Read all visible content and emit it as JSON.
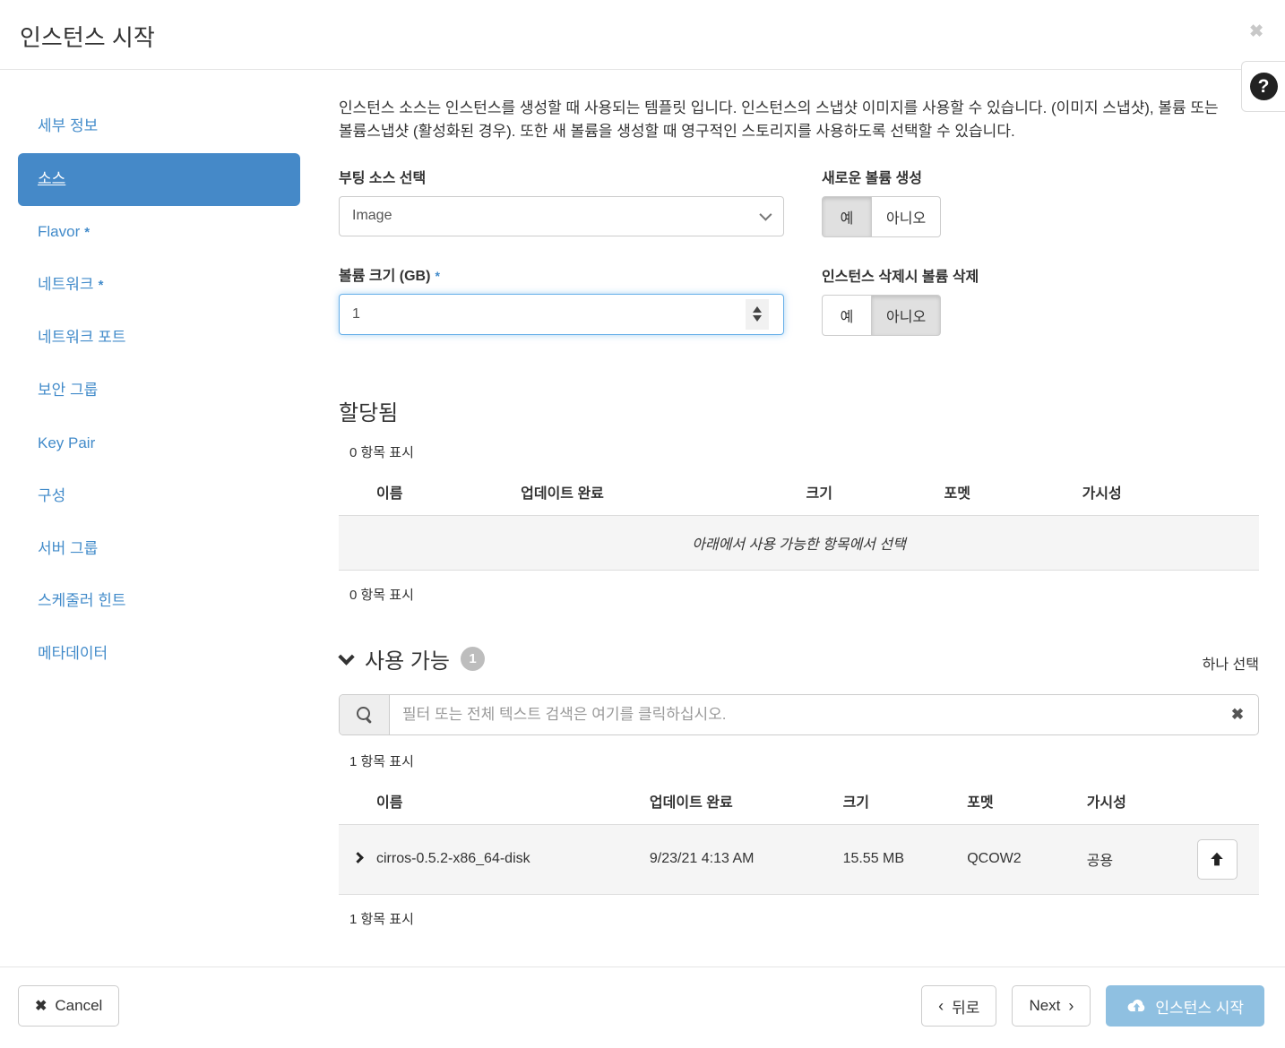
{
  "header": {
    "title": "인스턴스 시작",
    "close_icon": "✖",
    "help_icon": "?"
  },
  "sidebar": {
    "required_marker": "*",
    "items": [
      {
        "label": "세부 정보",
        "required": false,
        "active": false
      },
      {
        "label": "소스",
        "required": false,
        "active": true
      },
      {
        "label": "Flavor",
        "required": true,
        "active": false
      },
      {
        "label": "네트워크",
        "required": true,
        "active": false
      },
      {
        "label": "네트워크 포트",
        "required": false,
        "active": false
      },
      {
        "label": "보안 그룹",
        "required": false,
        "active": false
      },
      {
        "label": "Key Pair",
        "required": false,
        "active": false
      },
      {
        "label": "구성",
        "required": false,
        "active": false
      },
      {
        "label": "서버 그룹",
        "required": false,
        "active": false
      },
      {
        "label": "스케줄러 힌트",
        "required": false,
        "active": false
      },
      {
        "label": "메타데이터",
        "required": false,
        "active": false
      }
    ]
  },
  "source": {
    "description": "인스턴스 소스는 인스턴스를 생성할 때 사용되는 템플릿 입니다. 인스턴스의 스냅샷 이미지를 사용할 수 있습니다. (이미지 스냅샷), 볼륨 또는 볼륨스냅샷 (활성화된 경우). 또한 새 볼륨을 생성할 때 영구적인 스토리지를 사용하도록 선택할 수 있습니다.",
    "boot_source": {
      "label": "부팅 소스 선택",
      "value": "Image"
    },
    "create_volume": {
      "label": "새로운 볼륨 생성",
      "yes": "예",
      "no": "아니오",
      "selected": "예"
    },
    "volume_size": {
      "label": "볼륨 크기 (GB)",
      "value": "1"
    },
    "delete_volume": {
      "label": "인스턴스 삭제시 볼륨 삭제",
      "yes": "예",
      "no": "아니오",
      "selected": "아니오"
    }
  },
  "allocated": {
    "title": "할당됨",
    "count_top": "0 항목 표시",
    "count_bottom": "0 항목 표시",
    "columns": [
      "이름",
      "업데이트 완료",
      "크기",
      "포멧",
      "가시성"
    ],
    "empty_text": "아래에서 사용 가능한 항목에서 선택"
  },
  "available": {
    "title": "사용 가능",
    "badge": "1",
    "select_hint": "하나 선택",
    "search_placeholder": "필터 또는 전체 텍스트 검색은 여기를 클릭하십시오.",
    "clear_icon": "✖",
    "count_top": "1 항목 표시",
    "count_bottom": "1 항목 표시",
    "columns": [
      "이름",
      "업데이트 완료",
      "크기",
      "포멧",
      "가시성"
    ],
    "rows": [
      {
        "name": "cirros-0.5.2-x86_64-disk",
        "updated": "9/23/21 4:13 AM",
        "size": "15.55 MB",
        "format": "QCOW2",
        "visibility": "공용"
      }
    ]
  },
  "footer": {
    "cancel_icon": "✖",
    "cancel": "Cancel",
    "back_icon": "‹",
    "back": "뒤로",
    "next": "Next",
    "next_icon": "›",
    "launch": "인스턴스 시작"
  },
  "colors": {
    "link_blue": "#428bca",
    "active_step_bg": "#4589c8",
    "launch_button_bg": "#8fc0e1",
    "focus_border": "#66afe9",
    "badge_bg": "#bdbdbd",
    "row_bg": "#f5f5f5"
  }
}
